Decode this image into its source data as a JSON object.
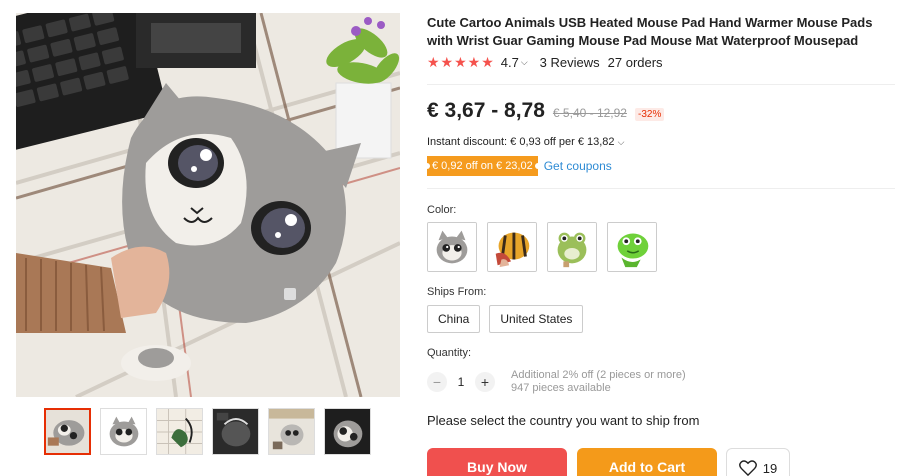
{
  "product": {
    "title": "Cute Cartoo Animals USB Heated Mouse Pad Hand Warmer Mouse Pads with Wrist Guar Gaming Mouse Pad Mouse Mat Waterproof Mousepad",
    "stars": "★★★★★",
    "rating": "4.7",
    "reviews": "3 Reviews",
    "orders": "27 orders"
  },
  "price": {
    "current": "€ 3,67 - 8,78",
    "original": "€ 5,40 - 12,92",
    "discount": "-32%",
    "instant_discount": "Instant discount: € 0,93 off per € 13,82",
    "coupon_tag": "€ 0,92 off on € 23,02",
    "get_coupons": "Get coupons"
  },
  "color": {
    "label": "Color:",
    "options": [
      "gray-cat",
      "bee",
      "green-frog",
      "green-dino"
    ]
  },
  "ships_from": {
    "label": "Ships From:",
    "options": [
      "China",
      "United States"
    ]
  },
  "quantity": {
    "label": "Quantity:",
    "minus": "−",
    "value": "1",
    "plus": "+",
    "additional": "Additional 2% off (2 pieces or more)",
    "available": "947 pieces available"
  },
  "ship_note": "Please select the country you want to ship from",
  "actions": {
    "buy_now": "Buy Now",
    "add_to_cart": "Add to Cart",
    "wishlist_count": "19"
  },
  "icons": {
    "chevron": "chevron-down-icon",
    "heart": "heart-icon"
  },
  "colors": {
    "accent_red": "#f0504e",
    "accent_orange": "#f49a1a",
    "link_blue": "#2e8bd4",
    "star_red": "#f5524d"
  }
}
